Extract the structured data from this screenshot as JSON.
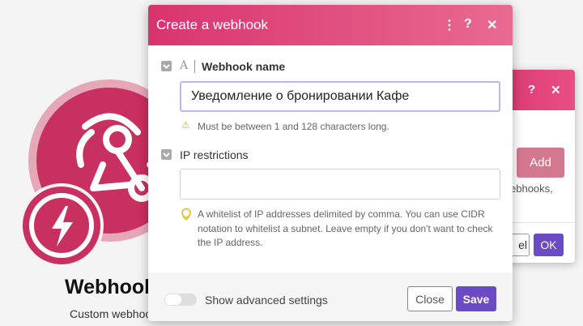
{
  "background_module": {
    "title": "Webhook",
    "subtitle": "Custom webhook",
    "icon": "webhook-icon",
    "badge_icon": "lightning-bolt-icon",
    "color": "#c8305f"
  },
  "back_dialog": {
    "add_label": "Add",
    "text": "ebhooks,",
    "cancel_label": "el",
    "ok_label": "OK"
  },
  "dialog": {
    "title": "Create a webhook",
    "header_icons": [
      "more-vert-icon",
      "help-icon",
      "close-icon"
    ],
    "webhook_name": {
      "label": "Webhook name",
      "value": "Уведомление о бронировании Кафе",
      "hint": "Must be between 1 and 128 characters long."
    },
    "ip_restrictions": {
      "label": "IP restrictions",
      "value": "",
      "hint": "A whitelist of IP addresses delimited by comma. You can use CIDR notation to whitelist a subnet. Leave empty if you don't want to check the IP address."
    },
    "footer": {
      "advanced_label": "Show advanced settings",
      "advanced_enabled": false,
      "close_label": "Close",
      "save_label": "Save"
    }
  },
  "colors": {
    "header": "#d8346f",
    "primary": "#6a4bc4",
    "focus": "#c2b3e8"
  }
}
